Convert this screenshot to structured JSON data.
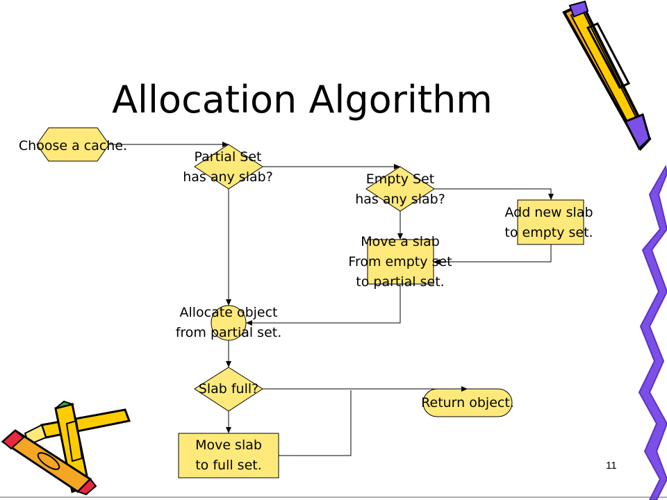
{
  "slide": {
    "title": "Allocation Algorithm",
    "page_number": "11"
  },
  "flowchart": {
    "nodes": {
      "choose_cache": "Choose a cache.",
      "partial_set_check": [
        "Partial Set",
        "has any slab?"
      ],
      "empty_set_check": [
        "Empty Set",
        "has any slab?"
      ],
      "add_new_slab": [
        "Add new slab",
        "to empty set."
      ],
      "move_slab_empty_to_partial": [
        "Move a slab",
        "From empty set",
        "to partial set."
      ],
      "allocate_object": [
        "Allocate object",
        "from partial set."
      ],
      "slab_full_check": "Slab full?",
      "move_slab_full": [
        "Move slab",
        "to full set."
      ],
      "return_object": "Return object."
    }
  },
  "colors": {
    "shape_fill": "#FFE97A",
    "line": "#000000",
    "pencil_yellow": "#FFCC00",
    "pencil_orange": "#F5A623",
    "ribbon_purple": "#7B4FE8",
    "crayon_red": "#E8283C",
    "crayon_green": "#2BAE3A"
  },
  "decorations": [
    "pencil-icon",
    "crayons-icon",
    "purple-ribbon-icon"
  ]
}
